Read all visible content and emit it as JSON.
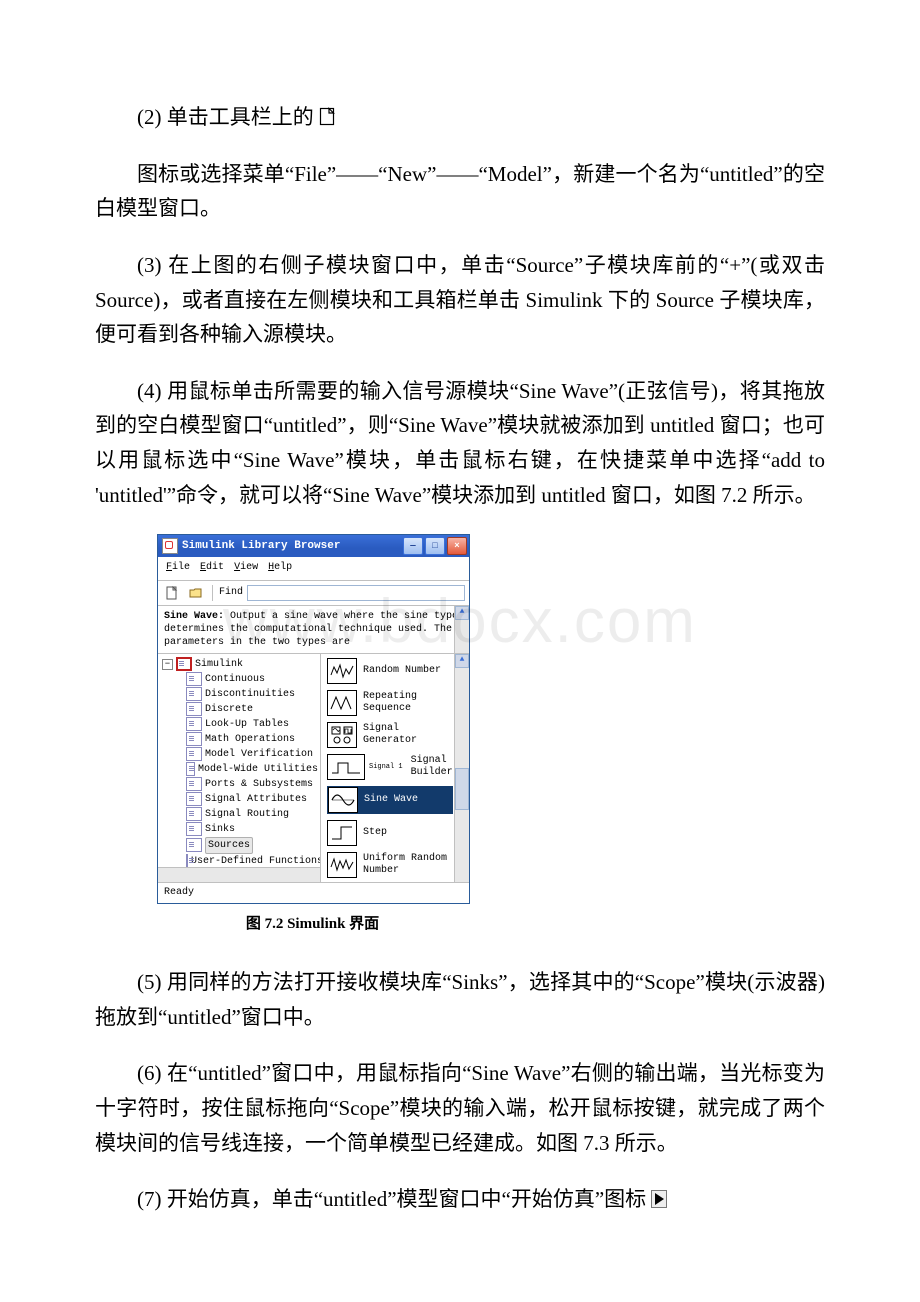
{
  "paragraphs": {
    "p2_pre": "(2) 单击工具栏上的",
    "p2_post": "",
    "p3": "图标或选择菜单“File”——“New”——“Model”，新建一个名为“untitled”的空白模型窗口。",
    "p4": "(3) 在上图的右侧子模块窗口中，单击“Source”子模块库前的“+”(或双击 Source)，或者直接在左侧模块和工具箱栏单击 Simulink 下的 Source 子模块库，便可看到各种输入源模块。",
    "p5": "(4) 用鼠标单击所需要的输入信号源模块“Sine Wave”(正弦信号)，将其拖放到的空白模型窗口“untitled”，则“Sine Wave”模块就被添加到 untitled 窗口；也可以用鼠标选中“Sine Wave”模块，单击鼠标右键，在快捷菜单中选择“add to 'untitled'”命令，就可以将“Sine Wave”模块添加到 untitled 窗口，如图 7.2 所示。",
    "p6": " (5) 用同样的方法打开接收模块库“Sinks”，选择其中的“Scope”模块(示波器)拖放到“untitled”窗口中。",
    "p7": "(6) 在“untitled”窗口中，用鼠标指向“Sine Wave”右侧的输出端，当光标变为十字符时，按住鼠标拖向“Scope”模块的输入端，松开鼠标按键，就完成了两个模块间的信号线连接，一个简单模型已经建成。如图 7.3 所示。",
    "p8_pre": "(7) 开始仿真，单击“untitled”模型窗口中“开始仿真”图标",
    "p8_post": ""
  },
  "figure": {
    "caption": "图 7.2 Simulink 界面",
    "title": "Simulink Library Browser",
    "menu": {
      "file": "File",
      "edit": "Edit",
      "view": "View",
      "help": "Help"
    },
    "toolbar": {
      "find_label": "Find"
    },
    "desc": {
      "bold": "Sine Wave:",
      "text": " Output a sine wave where the sine type determines the computational technique used. The parameters in the two types are"
    },
    "tree": {
      "root": "Simulink",
      "children": [
        "Continuous",
        "Discontinuities",
        "Discrete",
        "Look-Up Tables",
        "Math Operations",
        "Model Verification",
        "Model-Wide Utilities",
        "Ports & Subsystems",
        "Signal Attributes",
        "Signal Routing",
        "Sinks",
        "Sources",
        "User-Defined Functions"
      ],
      "selected": "Sources"
    },
    "blocks": [
      {
        "label": "Random Number"
      },
      {
        "label": "Repeating Sequence"
      },
      {
        "label": "Signal Generator"
      },
      {
        "label": "Signal Builder",
        "extra": "Signal 1"
      },
      {
        "label": "Sine Wave",
        "selected": true
      },
      {
        "label": "Step"
      },
      {
        "label": "Uniform Random Number"
      }
    ],
    "status": "Ready"
  },
  "watermark": "www.bdocx.com"
}
